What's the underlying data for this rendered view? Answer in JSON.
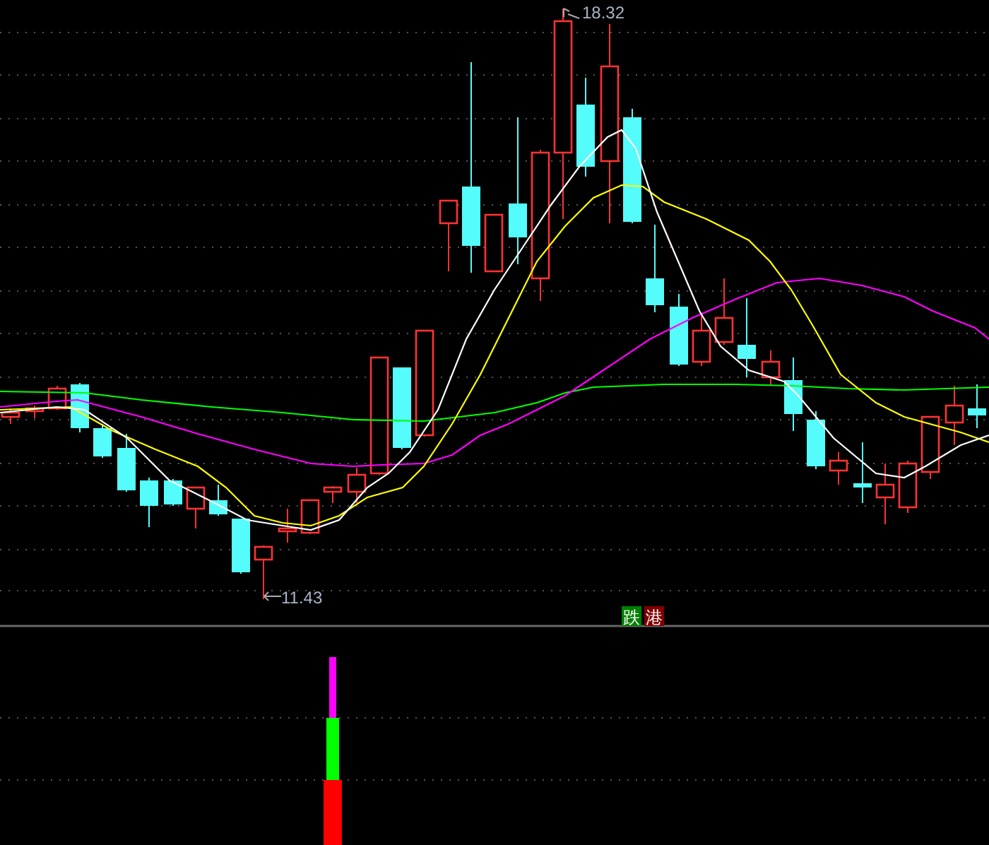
{
  "price_chart": {
    "high_label": "18.32",
    "low_label": "11.43"
  },
  "signal_markers": [
    {
      "label": "跌",
      "color": "#008000"
    },
    {
      "label": "港",
      "color": "#800000"
    }
  ]
}
